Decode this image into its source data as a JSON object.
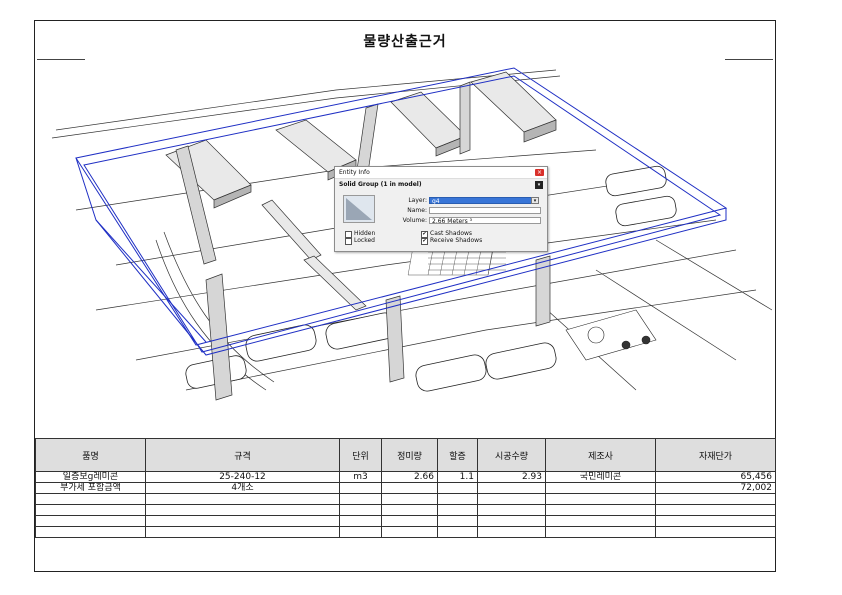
{
  "title": "물량산출근거",
  "entity_info": {
    "window_title": "Entity Info",
    "close_label": "×",
    "group_label": "Solid Group (1 in model)",
    "pin_label": "▾",
    "layer_label": "Layer:",
    "layer_value": "g4",
    "name_label": "Name:",
    "name_value": "",
    "volume_label": "Volume:",
    "volume_value": "2.66 Meters ³",
    "hidden_label": "Hidden",
    "locked_label": "Locked",
    "cast_shadows_label": "Cast Shadows",
    "receive_shadows_label": "Receive Shadows",
    "hidden_checked": false,
    "locked_checked": false,
    "cast_shadows_checked": true,
    "receive_shadows_checked": true,
    "dropdown_icon": "▾",
    "check_mark": "✔"
  },
  "table": {
    "headers": [
      "품명",
      "규격",
      "단위",
      "정미량",
      "할증",
      "시공수량",
      "제조사",
      "자재단가"
    ],
    "rows": [
      [
        "일증보g레미콘",
        "25-240-12",
        "m3",
        "2.66",
        "1.1",
        "2.93",
        "국민레미콘",
        "65,456"
      ],
      [
        "부가세 포함금액",
        "4개소",
        "",
        "",
        "",
        "",
        "",
        "72,002"
      ],
      [
        "",
        "",
        "",
        "",
        "",
        "",
        "",
        ""
      ],
      [
        "",
        "",
        "",
        "",
        "",
        "",
        "",
        ""
      ],
      [
        "",
        "",
        "",
        "",
        "",
        "",
        "",
        ""
      ],
      [
        "",
        "",
        "",
        "",
        "",
        "",
        "",
        ""
      ]
    ]
  },
  "colors": {
    "selection": "#1f2fc4",
    "beam_top": "#e9e9e9",
    "beam_side": "#b5b5b5",
    "header_bg": "#dedede"
  }
}
